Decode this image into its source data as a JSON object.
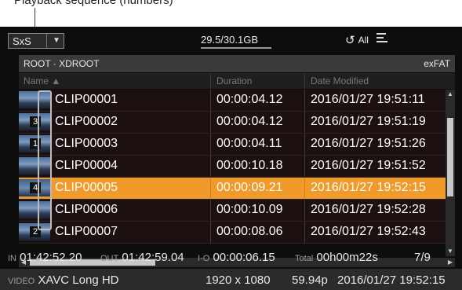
{
  "annotation": {
    "text": "Playback sequence (numbers)"
  },
  "topbar": {
    "media_label": "SxS",
    "capacity": "29.5/30.1GB",
    "loop_label": "All"
  },
  "pathbar": {
    "path": "ROOT · XDROOT",
    "filesystem": "exFAT"
  },
  "columns": {
    "name": "Name ▲",
    "duration": "Duration",
    "date": "Date Modified"
  },
  "clips": [
    {
      "num": "",
      "name": "CLIP00001",
      "duration": "00:00:04.12",
      "date": "2016/01/27 19:51:11"
    },
    {
      "num": "3",
      "name": "CLIP00002",
      "duration": "00:00:04.12",
      "date": "2016/01/27 19:51:19"
    },
    {
      "num": "1",
      "name": "CLIP00003",
      "duration": "00:00:04.11",
      "date": "2016/01/27 19:51:26"
    },
    {
      "num": "",
      "name": "CLIP00004",
      "duration": "00:00:10.18",
      "date": "2016/01/27 19:51:52"
    },
    {
      "num": "4",
      "name": "CLIP00005",
      "duration": "00:00:09.21",
      "date": "2016/01/27 19:52:15"
    },
    {
      "num": "",
      "name": "CLIP00006",
      "duration": "00:00:10.09",
      "date": "2016/01/27 19:52:28"
    },
    {
      "num": "2",
      "name": "CLIP00007",
      "duration": "00:00:08.06",
      "date": "2016/01/27 19:52:43"
    }
  ],
  "selected_index": 4,
  "info": {
    "in_label": "IN",
    "in_value": "01:42:52.20",
    "out_label": "OUT",
    "out_value": "01:42:59.04",
    "io_label": "I-O",
    "io_value": "00:00:06.15",
    "total_label": "Total",
    "total_value": "00h00m22s",
    "position": "7/9"
  },
  "bottom": {
    "video_label": "VIDEO",
    "codec": "XAVC Long HD",
    "resolution": "1920 x 1080",
    "framerate": "59.94p",
    "datetime": "2016/01/27 19:52:15"
  },
  "colors": {
    "selected_row": "#f19a2a",
    "background": "#0d0d0d",
    "row_bg": "#1c1010"
  }
}
